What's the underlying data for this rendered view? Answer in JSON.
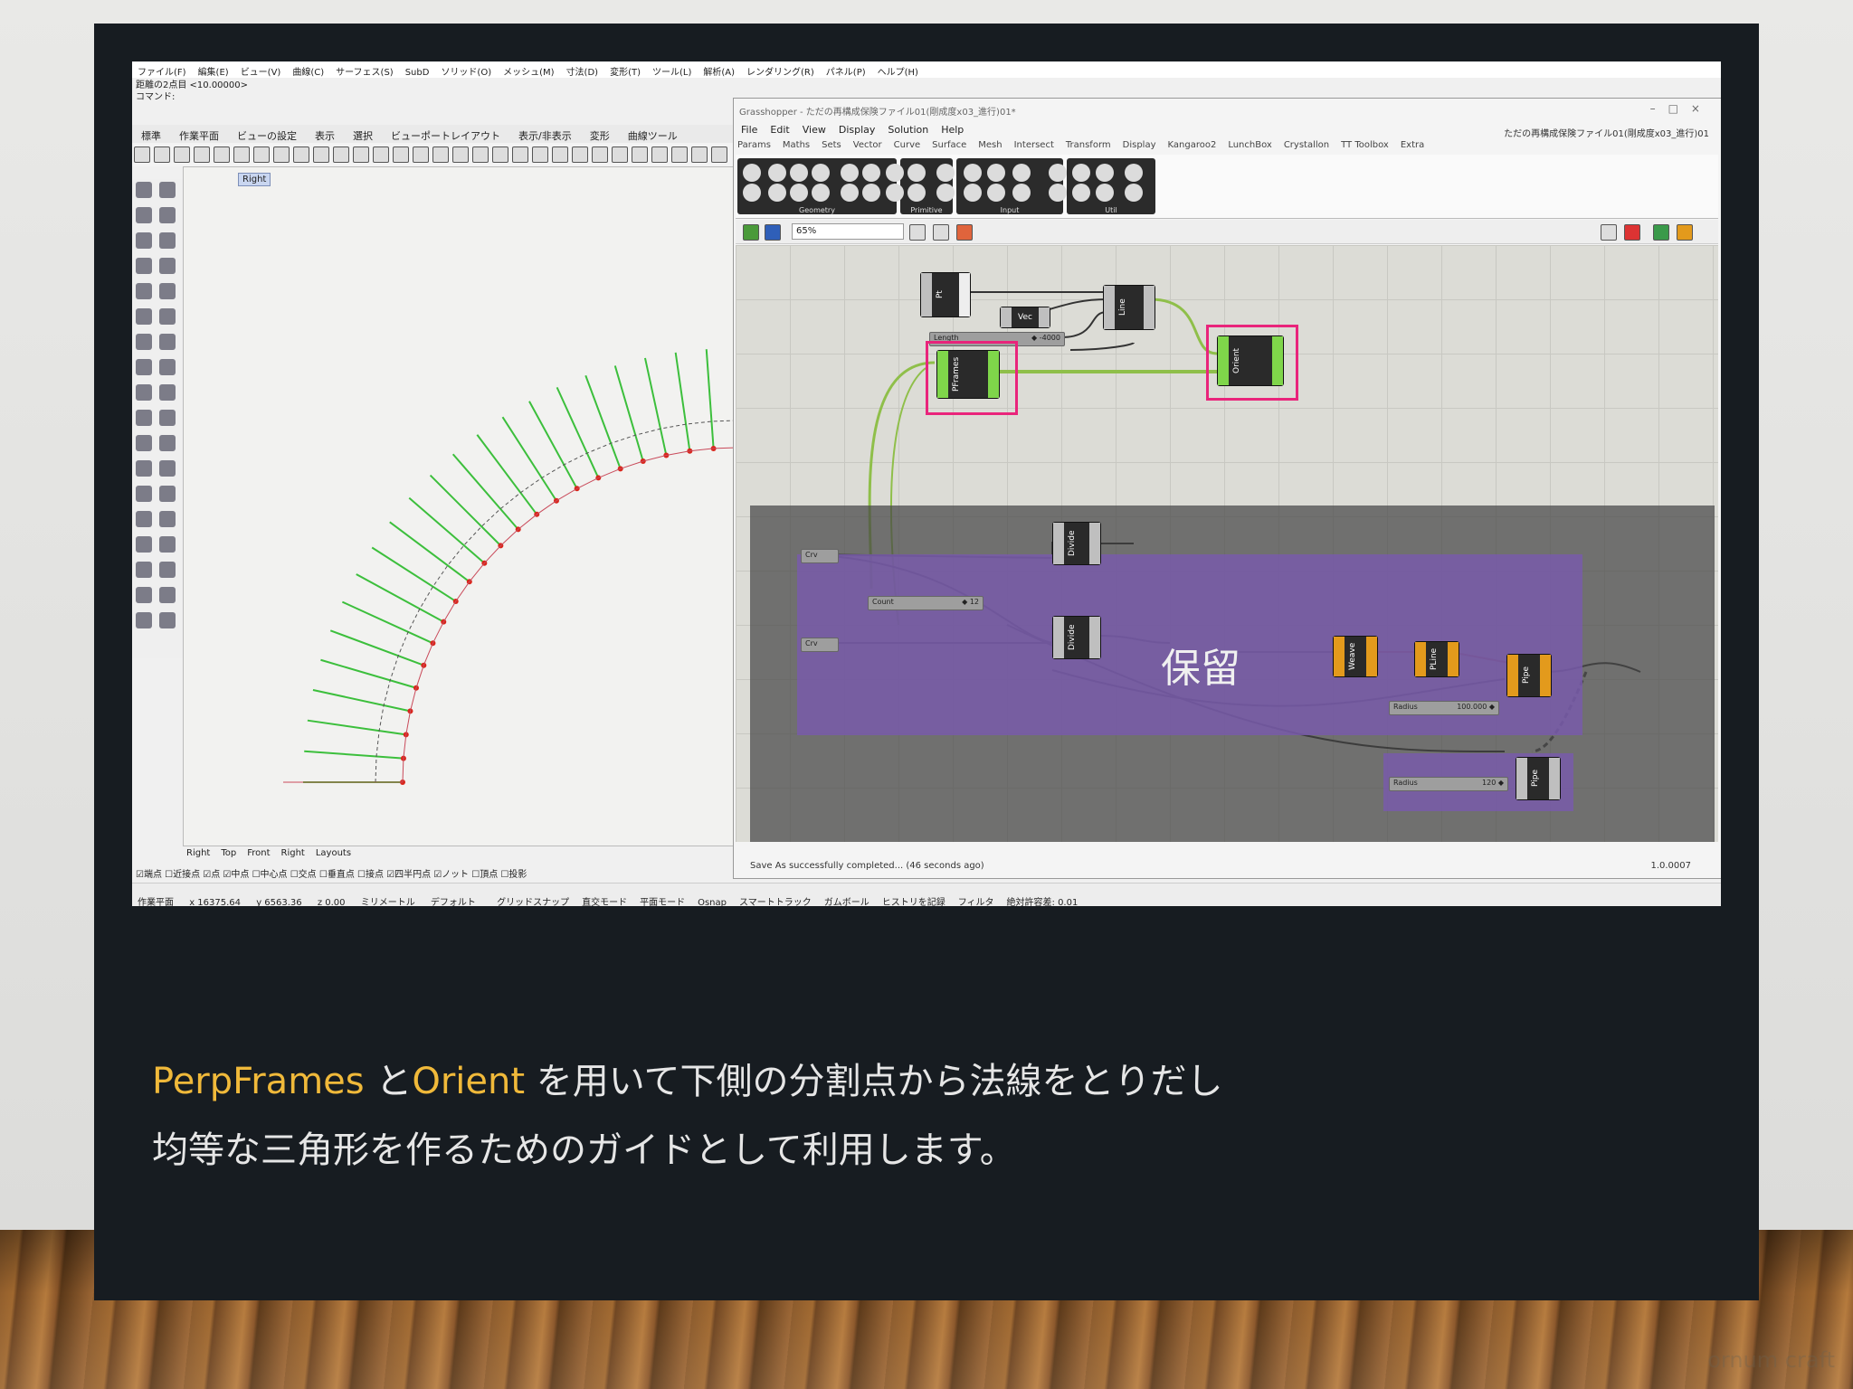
{
  "rhino": {
    "menu": [
      "ファイル(F)",
      "編集(E)",
      "ビュー(V)",
      "曲線(C)",
      "サーフェス(S)",
      "SubD",
      "ソリッド(O)",
      "メッシュ(M)",
      "寸法(D)",
      "変形(T)",
      "ツール(L)",
      "解析(A)",
      "レンダリング(R)",
      "パネル(P)",
      "ヘルプ(H)"
    ],
    "cmd_history": "距離の2点目 <10.00000>",
    "cmd_prompt": "コマンド:",
    "tabs": [
      "標準",
      "作業平面",
      "ビューの設定",
      "表示",
      "選択",
      "ビューポートレイアウト",
      "表示/非表示",
      "変形",
      "曲線ツール"
    ],
    "viewport_label": "Right",
    "view_tabs": [
      "Right",
      "Top",
      "Front",
      "Right",
      "Layouts"
    ],
    "osnap": "☑端点 ☐近接点 ☑点 ☑中点 ☐中心点 ☐交点 ☐垂直点 ☐接点 ☑四半円点 ☑ノット ☐頂点 ☐投影",
    "status": {
      "plane": "作業平面",
      "x": "x 16375.64",
      "y": "y 6563.36",
      "z": "z 0.00",
      "units": "ミリメートル",
      "layer": "デフォルト",
      "toggles": [
        "グリッドスナップ",
        "直交モード",
        "平面モード",
        "Osnap",
        "スマートトラック",
        "ガムボール",
        "ヒストリを記録",
        "フィルタ",
        "絶対許容差: 0.01"
      ]
    }
  },
  "grasshopper": {
    "title": "Grasshopper - ただの再構成保険ファイル01(剛成度x03_進行)01*",
    "doc_title": "ただの再構成保険ファイル01(剛成度x03_進行)01",
    "menu": [
      "File",
      "Edit",
      "View",
      "Display",
      "Solution",
      "Help"
    ],
    "tabs": [
      "Params",
      "Maths",
      "Sets",
      "Vector",
      "Curve",
      "Surface",
      "Mesh",
      "Intersect",
      "Transform",
      "Display",
      "Kangaroo2",
      "LunchBox",
      "Crystallon",
      "TT Toolbox",
      "Extra"
    ],
    "ribbon_groups": [
      "Geometry",
      "Primitive",
      "Input",
      "Util"
    ],
    "zoom": "65%",
    "components": {
      "pt": "Pt",
      "vec": "Vec",
      "line": "Line",
      "length_slider": {
        "name": "Length",
        "value": "◆ -4000"
      },
      "perpframes": "PFrames",
      "orient": "Orient",
      "divide1": "Divide",
      "divide2": "Divide",
      "count_slider": {
        "name": "Count",
        "value": "◆ 12"
      },
      "crv1": "Crv",
      "crv2": "Crv",
      "weave": "Weave",
      "pline": "PLine",
      "pipe1": "Pipe",
      "pipe2": "Pipe",
      "radius1": {
        "name": "Radius",
        "value": "100.000 ◆"
      },
      "radius2": {
        "name": "Radius",
        "value": "120 ◆"
      }
    },
    "hold_label": "保留",
    "status": "Save As successfully completed... (46 seconds ago)",
    "version": "1.0.0007"
  },
  "caption": {
    "kw1": "PerpFrames",
    "sep1": " と",
    "kw2": "Orient",
    "line1_rest": " を用いて下側の分割点から法線をとりだし",
    "line2": "均等な三角形を作るためのガイドとして利用します。"
  },
  "watermark": "ornum craft",
  "colors": {
    "keyword": "#f0b93a",
    "highlight": "#e9247b",
    "slide_bg": "#171c21",
    "guide_lines": "#3cbf3c",
    "points": "#d9261c"
  },
  "curve_chart": {
    "arc_points": 23,
    "normals": 23
  }
}
